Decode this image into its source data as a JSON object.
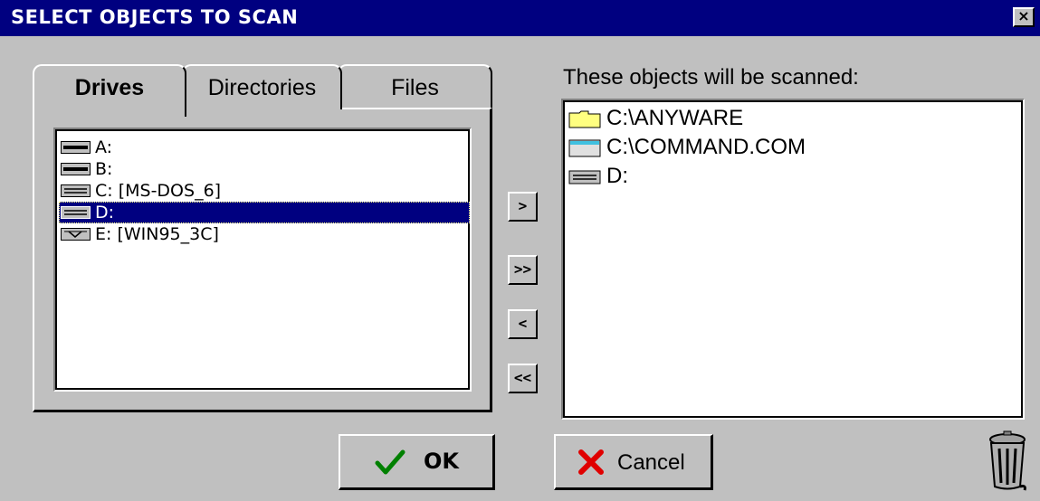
{
  "window": {
    "title": "SELECT OBJECTS TO SCAN",
    "close_label": "×"
  },
  "tabs": [
    {
      "label": "Drives",
      "active": true
    },
    {
      "label": "Directories",
      "active": false
    },
    {
      "label": "Files",
      "active": false
    }
  ],
  "drives": [
    {
      "label": "A:",
      "icon": "floppy-drive-icon",
      "selected": false
    },
    {
      "label": "B:",
      "icon": "floppy-drive-icon",
      "selected": false
    },
    {
      "label": "C: [MS-DOS_6]",
      "icon": "hard-drive-icon",
      "selected": false
    },
    {
      "label": "D:",
      "icon": "hard-drive-icon",
      "selected": true
    },
    {
      "label": "E: [WIN95_3C]",
      "icon": "removable-drive-icon",
      "selected": false
    }
  ],
  "move_buttons": {
    "add": ">",
    "add_all": ">>",
    "remove": "<",
    "remove_all": "<<"
  },
  "scan_list": {
    "label": "These objects will be scanned:",
    "items": [
      {
        "label": "C:\\ANYWARE",
        "icon": "folder-icon"
      },
      {
        "label": "C:\\COMMAND.COM",
        "icon": "file-icon"
      },
      {
        "label": "D:",
        "icon": "hard-drive-icon"
      }
    ]
  },
  "buttons": {
    "ok": "OK",
    "cancel": "Cancel"
  },
  "colors": {
    "titlebar": "#000080",
    "face": "#c0c0c0",
    "selection": "#000080",
    "ok_check": "#008000",
    "cancel_x": "#e00000",
    "folder": "#ffff80"
  }
}
